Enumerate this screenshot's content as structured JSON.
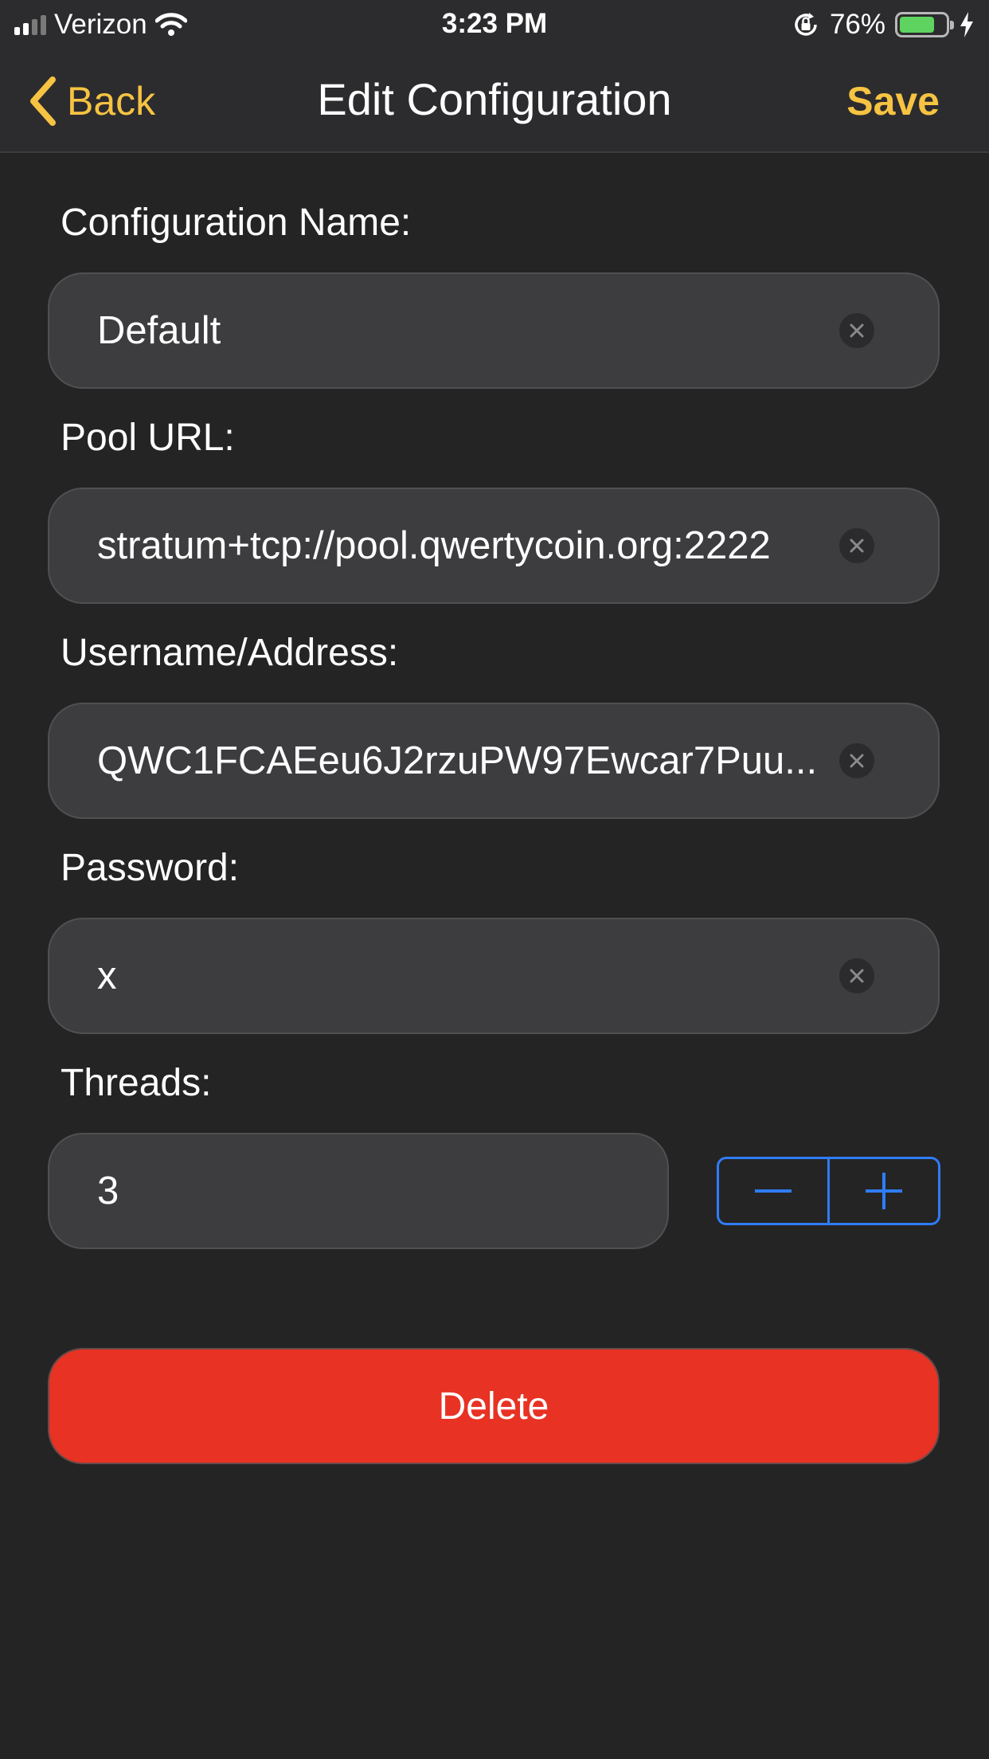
{
  "status_bar": {
    "carrier": "Verizon",
    "time": "3:23 PM",
    "battery_percent_text": "76%",
    "battery_level": 0.76,
    "icons": [
      "signal-icon",
      "wifi-icon",
      "rotation-lock-icon",
      "battery-icon",
      "charging-bolt-icon"
    ]
  },
  "nav": {
    "back_label": "Back",
    "title": "Edit Configuration",
    "save_label": "Save",
    "accent_color": "#f6c342"
  },
  "form": {
    "config_name": {
      "label": "Configuration Name:",
      "value": "Default"
    },
    "pool_url": {
      "label": "Pool URL:",
      "value": "stratum+tcp://pool.qwertycoin.org:2222"
    },
    "username": {
      "label": "Username/Address:",
      "value": "QWC1FCAEeu6J2rzuPW97Ewcar7Puu..."
    },
    "password": {
      "label": "Password:",
      "value": "x"
    },
    "threads": {
      "label": "Threads:",
      "value": "3"
    }
  },
  "stepper": {
    "minus": "−",
    "plus": "+",
    "color": "#2f7cf6"
  },
  "delete_label": "Delete",
  "colors": {
    "background": "#242424",
    "field": "#3d3d3f",
    "delete": "#e83224"
  }
}
